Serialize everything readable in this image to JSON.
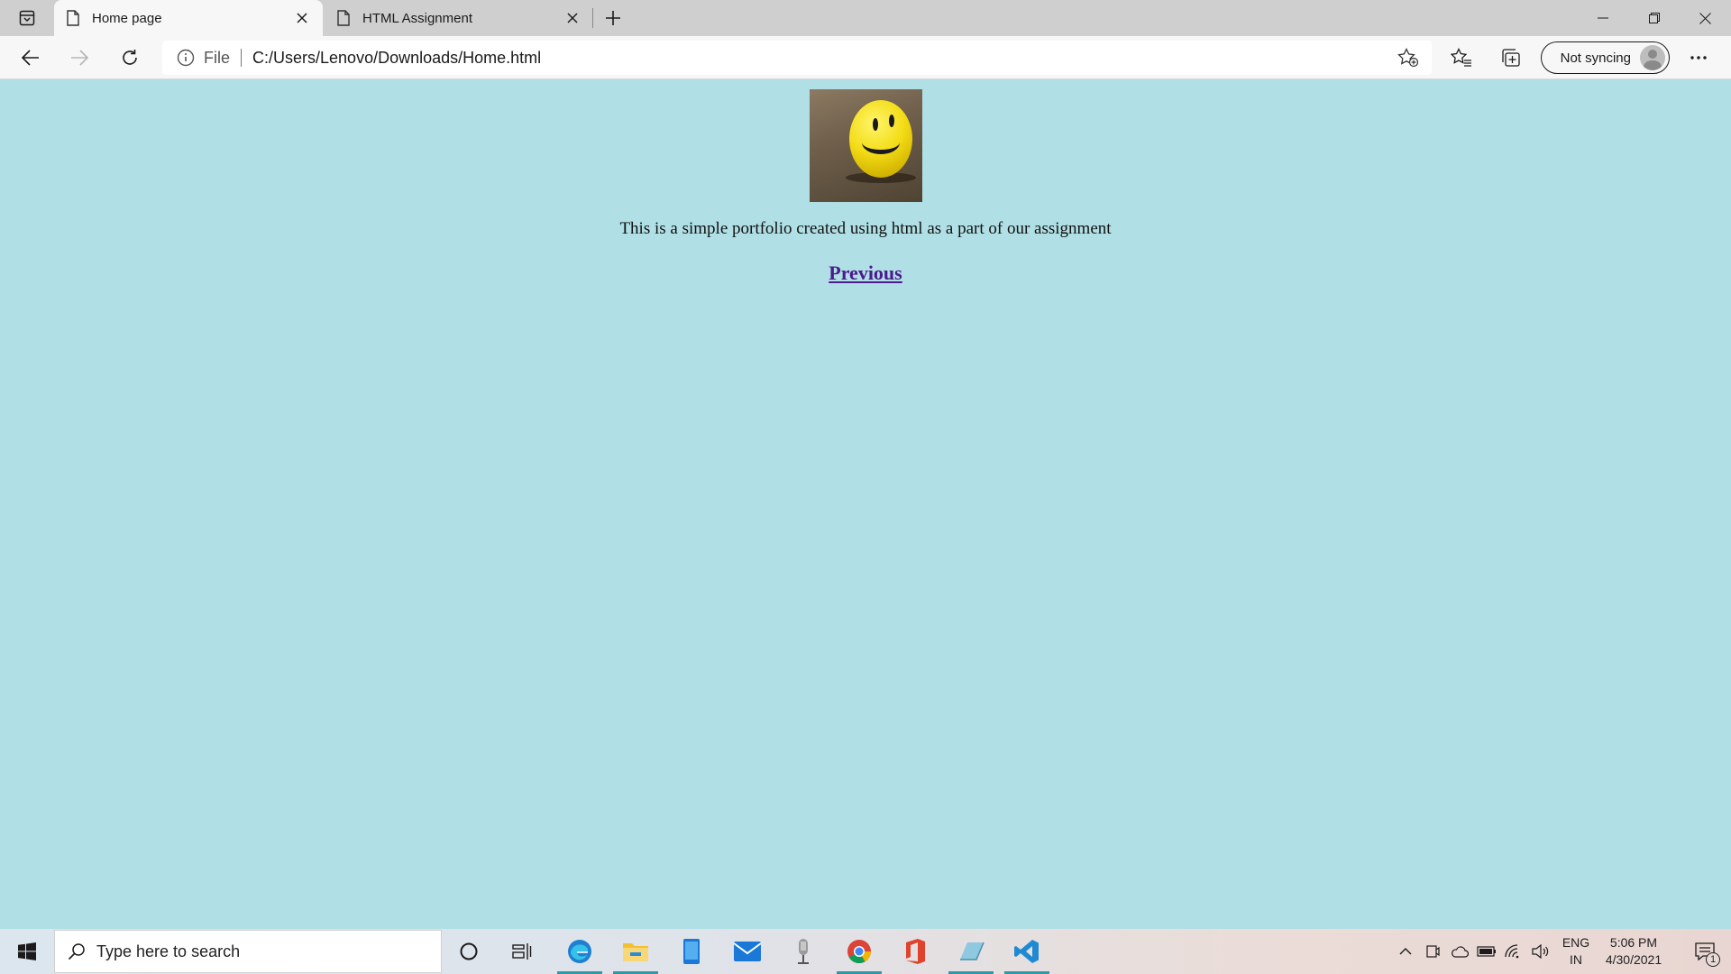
{
  "browser": {
    "tabs": [
      {
        "title": "Home page",
        "active": true
      },
      {
        "title": "HTML Assignment",
        "active": false
      }
    ],
    "address": {
      "scheme": "File",
      "url": "C:/Users/Lenovo/Downloads/Home.html"
    },
    "profile": {
      "label": "Not syncing"
    }
  },
  "page": {
    "description": "This is a simple portfolio created using html as a part of our assignment",
    "link_label": "Previous",
    "background": "#b0dfe5",
    "link_color": "#4b1a8c"
  },
  "taskbar": {
    "search_placeholder": "Type here to search",
    "pinned_apps": [
      "cortana-icon",
      "task-view-icon",
      "edge-icon",
      "file-explorer-icon",
      "phone-icon",
      "mail-icon",
      "mic-app-icon",
      "chrome-icon",
      "office-icon",
      "whiteboard-icon",
      "vscode-icon"
    ],
    "language": {
      "line1": "ENG",
      "line2": "IN"
    },
    "clock": {
      "time": "5:06 PM",
      "date": "4/30/2021"
    },
    "notification_count": "1"
  }
}
